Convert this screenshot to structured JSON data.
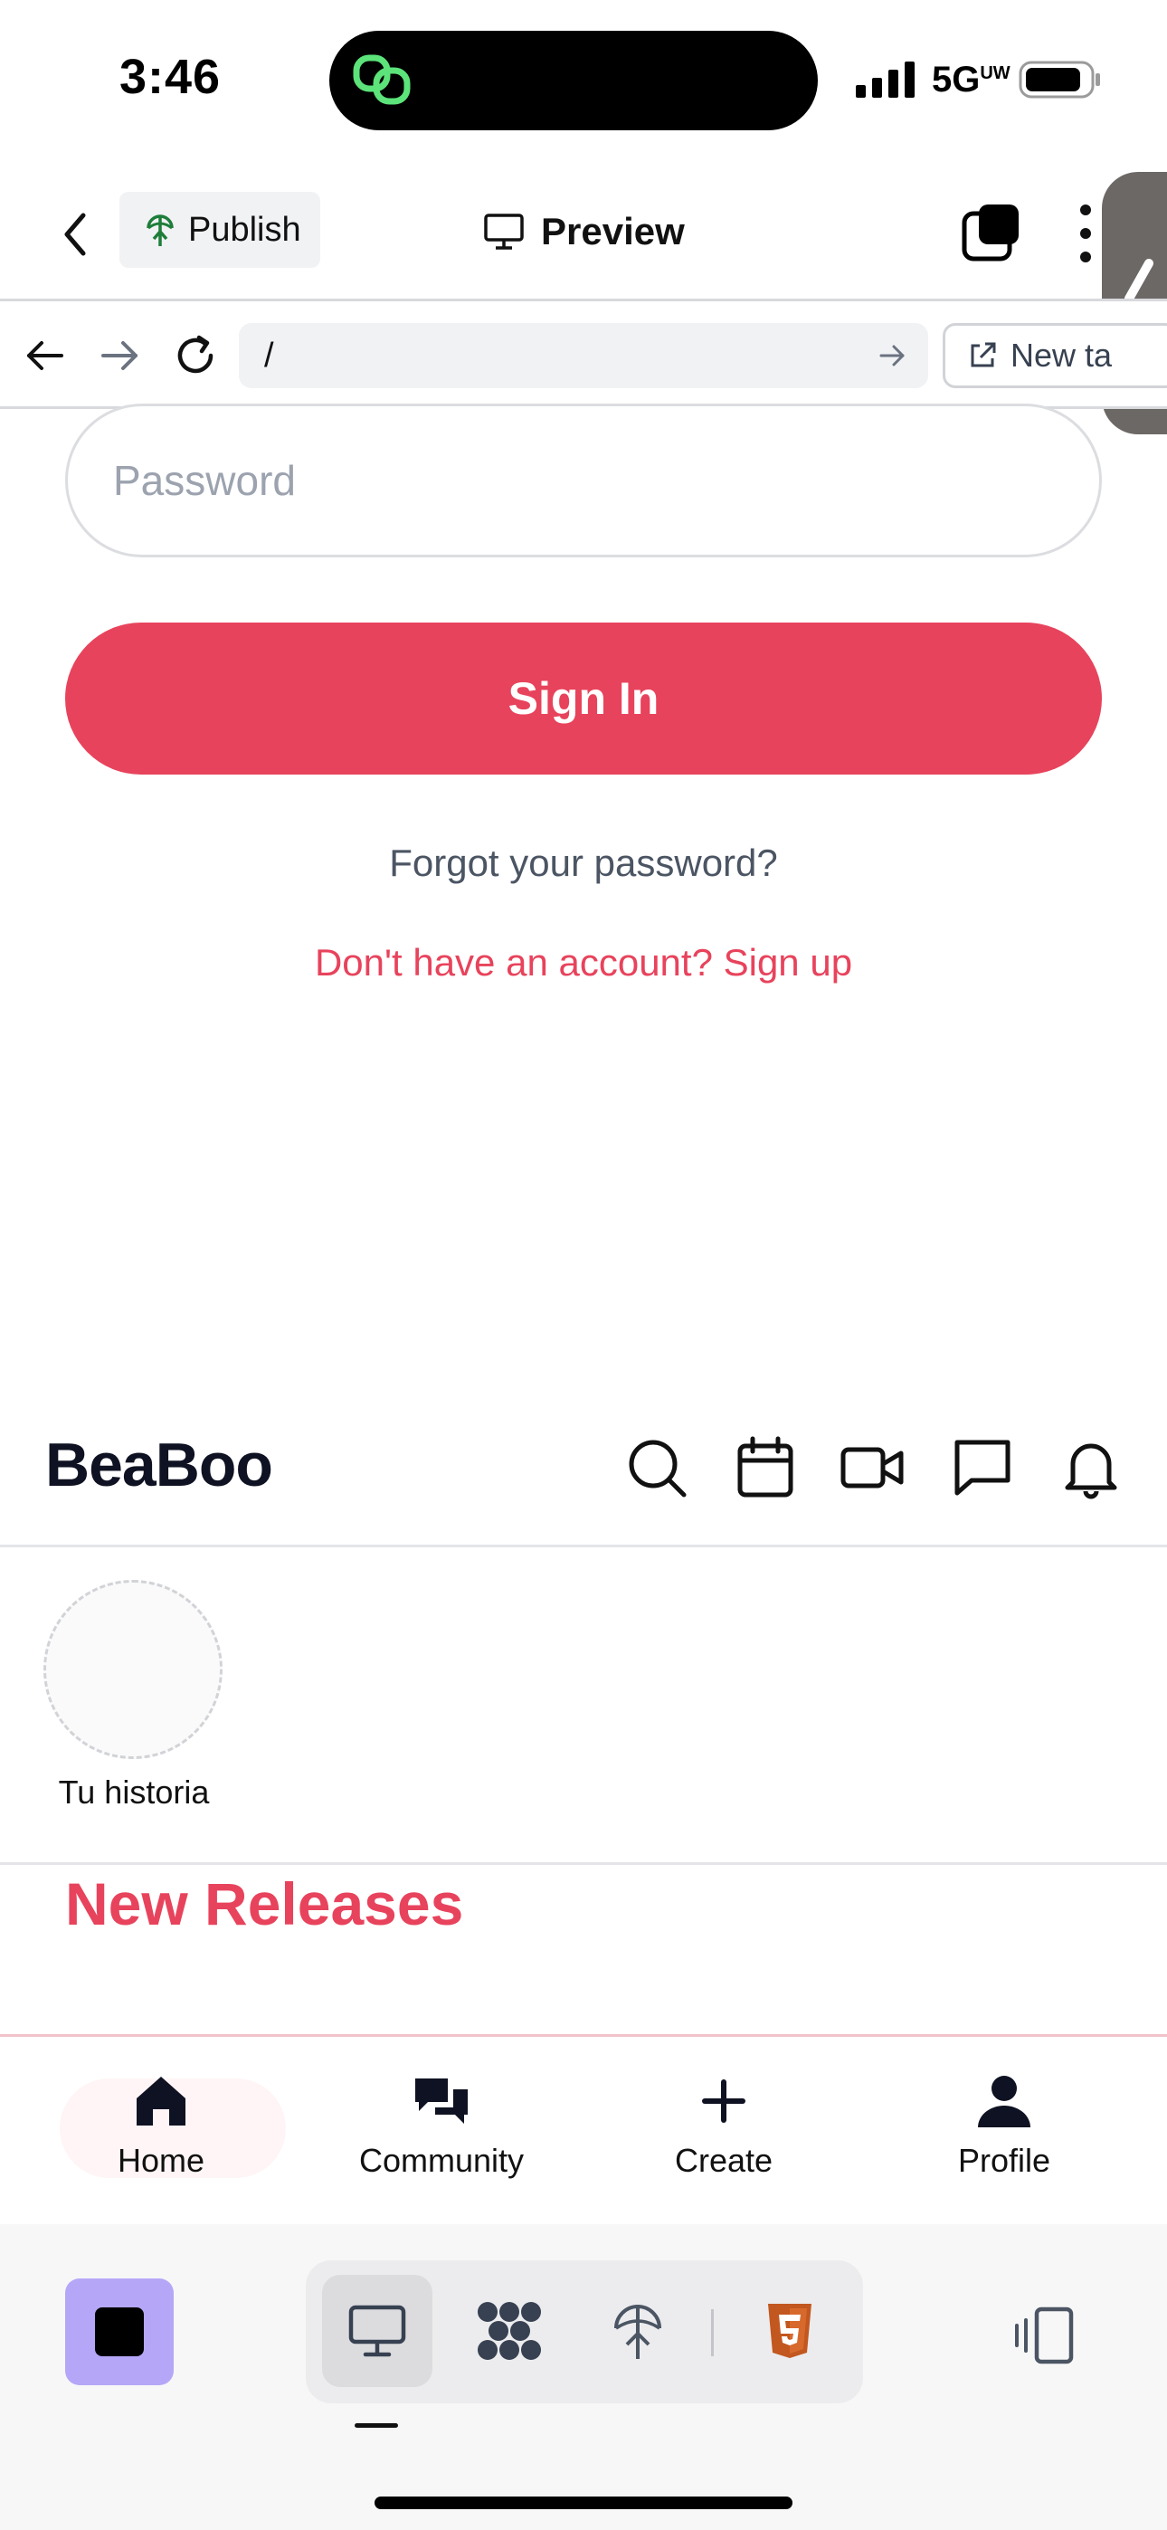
{
  "status_bar": {
    "time": "3:46",
    "network": "5G",
    "network_sup": "UW"
  },
  "editor_header": {
    "publish_label": "Publish",
    "preview_label": "Preview"
  },
  "browser_bar": {
    "url": "/",
    "new_tab_label": "New ta"
  },
  "signin": {
    "password_placeholder": "Password",
    "signin_label": "Sign In",
    "forgot_label": "Forgot your password?",
    "signup_label": "Don't have an account? Sign up"
  },
  "app": {
    "logo": "BeaBoo",
    "story_label": "Tu historia",
    "section_title": "New Releases",
    "nav": [
      {
        "label": "Home"
      },
      {
        "label": "Community"
      },
      {
        "label": "Create"
      },
      {
        "label": "Profile"
      }
    ]
  },
  "colors": {
    "brand": "#e8435c",
    "stop_button": "#b6a6f7",
    "html5_icon": "#c2571f"
  }
}
